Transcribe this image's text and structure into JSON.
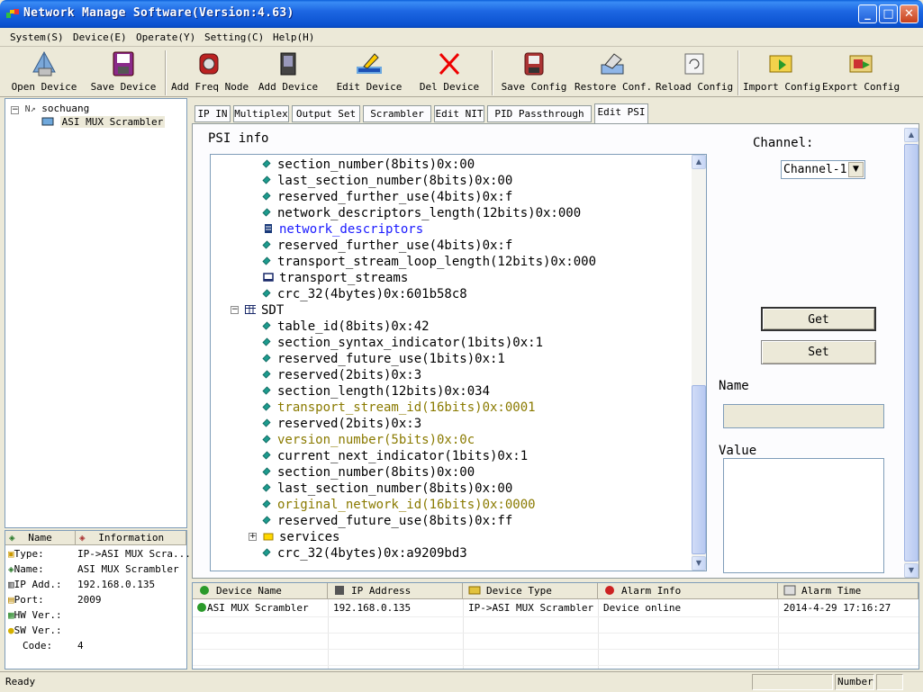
{
  "window": {
    "title": "Network Manage Software(Version:4.63)",
    "min_glyph": "_",
    "max_glyph": "□",
    "close_glyph": "✕"
  },
  "menu": [
    {
      "label": "System(S)"
    },
    {
      "label": "Device(E)"
    },
    {
      "label": "Operate(Y)"
    },
    {
      "label": "Setting(C)"
    },
    {
      "label": "Help(H)"
    }
  ],
  "toolbar": {
    "open_device": "Open Device",
    "save_device": "Save Device",
    "add_freq_node": "Add Freq Node",
    "add_device": "Add Device",
    "edit_device": "Edit Device",
    "del_device": "Del Device",
    "save_config": "Save Config",
    "restore_conf": "Restore Conf.",
    "reload_config": "Reload Config",
    "import_config": "Import Config",
    "export_config": "Export Config"
  },
  "tree": {
    "root": "sochuang",
    "child": "ASI MUX Scrambler"
  },
  "info_panel": {
    "col_name": "Name",
    "col_info": "Information",
    "rows": [
      {
        "key": "Type:",
        "value": "IP->ASI MUX Scra..."
      },
      {
        "key": "Name:",
        "value": "ASI MUX Scrambler"
      },
      {
        "key": "IP Add.:",
        "value": "192.168.0.135"
      },
      {
        "key": "Port:",
        "value": "2009"
      },
      {
        "key": "HW Ver.:",
        "value": ""
      },
      {
        "key": "SW Ver.:",
        "value": ""
      },
      {
        "key": "Code:",
        "value": "4"
      }
    ]
  },
  "tabs": [
    {
      "label": "IP IN"
    },
    {
      "label": "Multiplex"
    },
    {
      "label": "Output Set"
    },
    {
      "label": "Scrambler"
    },
    {
      "label": "Edit NIT"
    },
    {
      "label": "PID Passthrough"
    },
    {
      "label": "Edit PSI",
      "active": true
    }
  ],
  "psi": {
    "label": "PSI info",
    "rows": [
      {
        "text": "section_number(8bits)0x:00",
        "kind": "leaf"
      },
      {
        "text": "last_section_number(8bits)0x:00",
        "kind": "leaf"
      },
      {
        "text": "reserved_further_use(4bits)0x:f",
        "kind": "leaf"
      },
      {
        "text": "network_descriptors_length(12bits)0x:000",
        "kind": "leaf"
      },
      {
        "text": "network_descriptors",
        "kind": "list",
        "color": "blue"
      },
      {
        "text": "reserved_further_use(4bits)0x:f",
        "kind": "leaf"
      },
      {
        "text": "transport_stream_loop_length(12bits)0x:000",
        "kind": "leaf"
      },
      {
        "text": "transport_streams",
        "kind": "box"
      },
      {
        "text": "crc_32(4bytes)0x:601b58c8",
        "kind": "leaf"
      },
      {
        "text": "SDT",
        "kind": "table",
        "expander": "−"
      },
      {
        "text": "table_id(8bits)0x:42",
        "kind": "leaf"
      },
      {
        "text": "section_syntax_indicator(1bits)0x:1",
        "kind": "leaf"
      },
      {
        "text": "reserved_future_use(1bits)0x:1",
        "kind": "leaf"
      },
      {
        "text": "reserved(2bits)0x:3",
        "kind": "leaf"
      },
      {
        "text": "section_length(12bits)0x:034",
        "kind": "leaf"
      },
      {
        "text": "transport_stream_id(16bits)0x:0001",
        "kind": "leaf",
        "color": "olive"
      },
      {
        "text": "reserved(2bits)0x:3",
        "kind": "leaf"
      },
      {
        "text": "version_number(5bits)0x:0c",
        "kind": "leaf",
        "color": "olive"
      },
      {
        "text": "current_next_indicator(1bits)0x:1",
        "kind": "leaf"
      },
      {
        "text": "section_number(8bits)0x:00",
        "kind": "leaf"
      },
      {
        "text": "last_section_number(8bits)0x:00",
        "kind": "leaf"
      },
      {
        "text": "original_network_id(16bits)0x:0000",
        "kind": "leaf",
        "color": "olive"
      },
      {
        "text": "reserved_future_use(8bits)0x:ff",
        "kind": "leaf"
      },
      {
        "text": "services",
        "kind": "folder",
        "expander": "+"
      },
      {
        "text": "crc_32(4bytes)0x:a9209bd3",
        "kind": "leaf"
      }
    ]
  },
  "controls": {
    "channel_label": "Channel:",
    "channel_value": "Channel-1",
    "get_label": "Get",
    "set_label": "Set",
    "name_label": "Name",
    "value_label": "Value"
  },
  "device_list": {
    "columns": [
      "Device Name",
      "IP Address",
      "Device Type",
      "Alarm Info",
      "Alarm Time"
    ],
    "rows": [
      {
        "name": "ASI MUX Scrambler",
        "ip": "192.168.0.135",
        "type": "IP->ASI MUX Scrambler",
        "alarm": "Device online",
        "time": "2014-4-29 17:16:27"
      }
    ]
  },
  "status": {
    "text": "Ready",
    "number_label": "Number"
  },
  "colors": {
    "title_bar": "#0a51d0",
    "leaf_icon": "#1d9b8e",
    "blue_text": "#1a1aff",
    "olive_text": "#8a7a00"
  }
}
